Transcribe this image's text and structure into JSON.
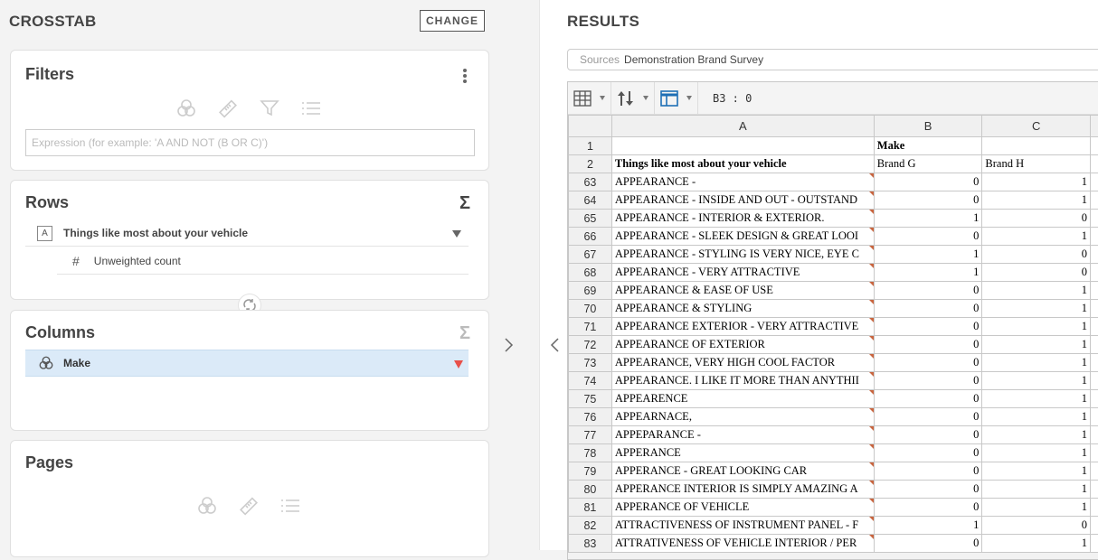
{
  "left_panel": {
    "title": "CROSSTAB",
    "change_label": "CHANGE",
    "filters": {
      "title": "Filters",
      "placeholder": "Expression (for example: 'A AND NOT (B OR C)')"
    },
    "rows": {
      "title": "Rows",
      "sigma": "Σ",
      "item_badge": "A",
      "item_label": "Things like most about your vehicle",
      "sub_hash": "#",
      "sub_label": "Unweighted count"
    },
    "columns": {
      "title": "Columns",
      "sigma": "Σ",
      "item_label": "Make"
    },
    "pages": {
      "title": "Pages"
    }
  },
  "results": {
    "title": "RESULTS",
    "sources_key": "Sources",
    "sources_value": "Demonstration Brand Survey",
    "cell_ref": "B3 : 0",
    "col_headers": [
      "A",
      "B",
      "C"
    ],
    "header_rows": [
      {
        "rn": "1",
        "a": "",
        "b": "Make",
        "c": ""
      },
      {
        "rn": "2",
        "a": "Things like most about your vehicle",
        "b": "Brand G",
        "c": "Brand H"
      }
    ],
    "rows": [
      {
        "rn": "63",
        "a": "APPEARANCE -",
        "b": "0",
        "c": "1"
      },
      {
        "rn": "64",
        "a": "APPEARANCE - INSIDE AND OUT - OUTSTAND",
        "b": "0",
        "c": "1"
      },
      {
        "rn": "65",
        "a": "APPEARANCE - INTERIOR & EXTERIOR.",
        "b": "1",
        "c": "0"
      },
      {
        "rn": "66",
        "a": "APPEARANCE - SLEEK DESIGN & GREAT LOOI",
        "b": "0",
        "c": "1"
      },
      {
        "rn": "67",
        "a": "APPEARANCE - STYLING IS VERY NICE, EYE C",
        "b": "1",
        "c": "0"
      },
      {
        "rn": "68",
        "a": "APPEARANCE - VERY ATTRACTIVE",
        "b": "1",
        "c": "0"
      },
      {
        "rn": "69",
        "a": "APPEARANCE & EASE OF USE",
        "b": "0",
        "c": "1"
      },
      {
        "rn": "70",
        "a": "APPEARANCE & STYLING",
        "b": "0",
        "c": "1"
      },
      {
        "rn": "71",
        "a": "APPEARANCE EXTERIOR - VERY ATTRACTIVE",
        "b": "0",
        "c": "1"
      },
      {
        "rn": "72",
        "a": "APPEARANCE OF EXTERIOR",
        "b": "0",
        "c": "1"
      },
      {
        "rn": "73",
        "a": "APPEARANCE, VERY HIGH COOL FACTOR",
        "b": "0",
        "c": "1"
      },
      {
        "rn": "74",
        "a": "APPEARANCE. I LIKE IT MORE THAN ANYTHII",
        "b": "0",
        "c": "1"
      },
      {
        "rn": "75",
        "a": "APPEARENCE",
        "b": "0",
        "c": "1"
      },
      {
        "rn": "76",
        "a": "APPEARNACE,",
        "b": "0",
        "c": "1"
      },
      {
        "rn": "77",
        "a": "APPEPARANCE -",
        "b": "0",
        "c": "1"
      },
      {
        "rn": "78",
        "a": "APPERANCE",
        "b": "0",
        "c": "1"
      },
      {
        "rn": "79",
        "a": "APPERANCE - GREAT LOOKING CAR",
        "b": "0",
        "c": "1"
      },
      {
        "rn": "80",
        "a": "APPERANCE INTERIOR IS SIMPLY AMAZING A",
        "b": "0",
        "c": "1"
      },
      {
        "rn": "81",
        "a": "APPERANCE OF VEHICLE",
        "b": "0",
        "c": "1"
      },
      {
        "rn": "82",
        "a": "ATTRACTIVENESS OF INSTRUMENT PANEL - F",
        "b": "1",
        "c": "0"
      },
      {
        "rn": "83",
        "a": "ATTRATIVENESS OF VEHICLE INTERIOR / PER",
        "b": "0",
        "c": "1"
      }
    ]
  }
}
